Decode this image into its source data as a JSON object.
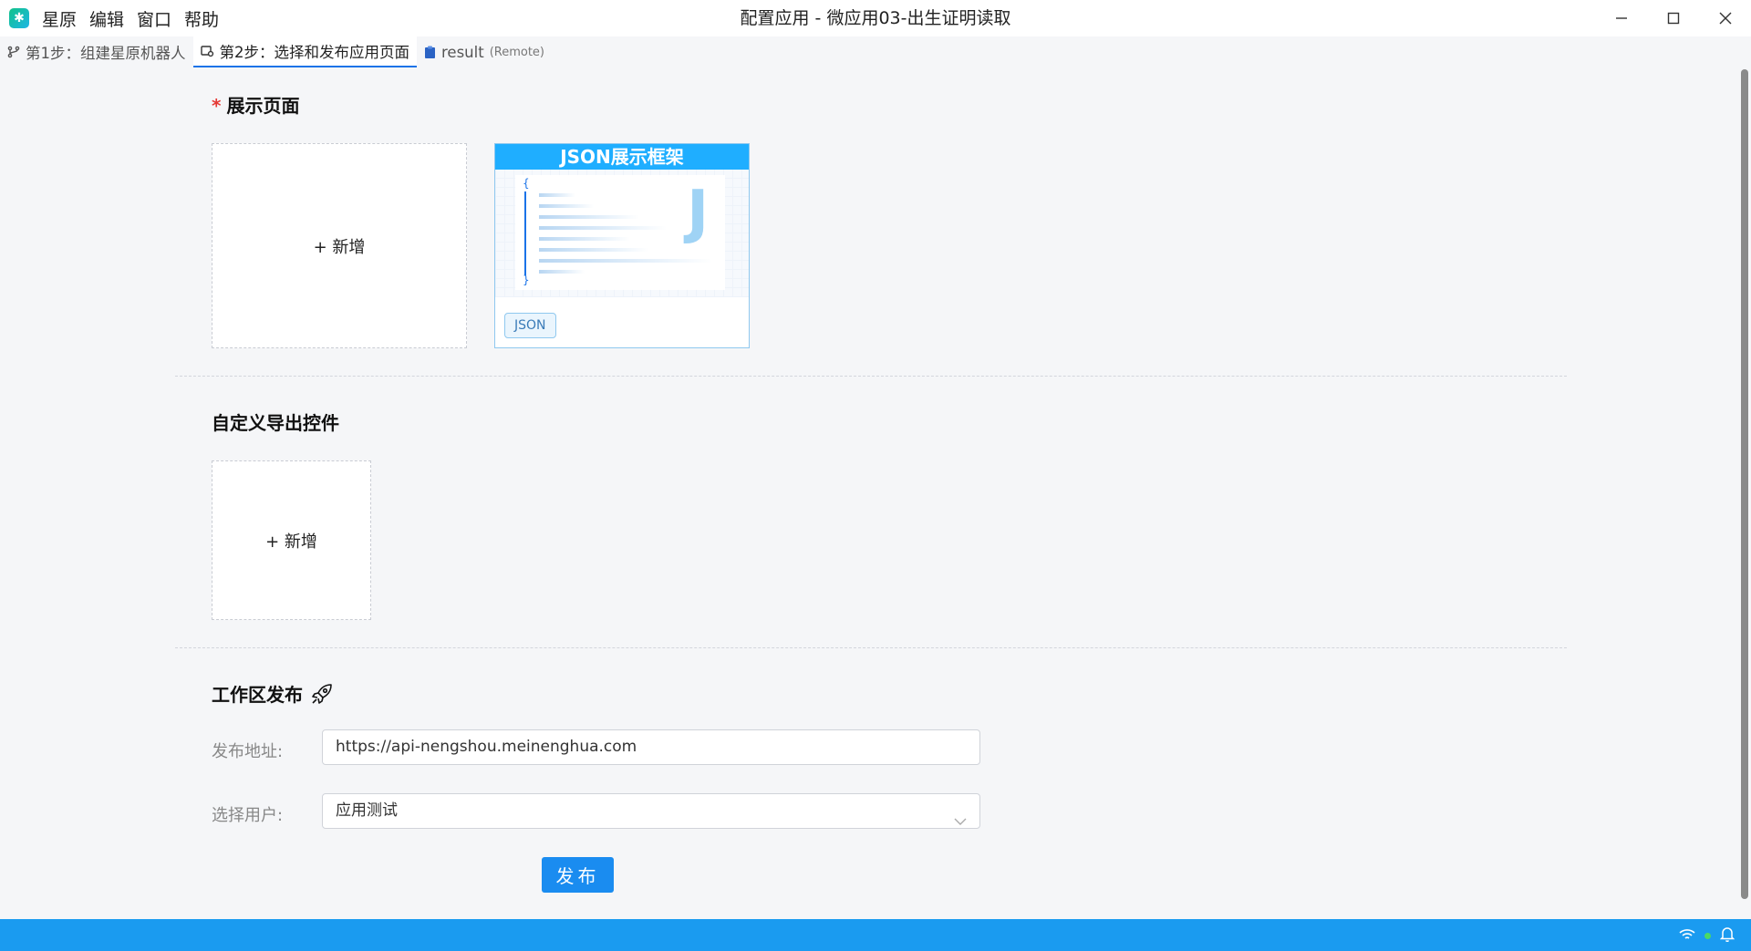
{
  "app": {
    "menu": [
      "星原",
      "编辑",
      "窗口",
      "帮助"
    ],
    "window_title": "配置应用 - 微应用03-出生证明读取"
  },
  "tabs": [
    {
      "label": "第1步：组建星原机器人",
      "icon": "branch-icon"
    },
    {
      "label": "第2步：选择和发布应用页面",
      "icon": "page-settings-icon"
    },
    {
      "label": "result",
      "suffix": "(Remote)",
      "icon": "clipboard-icon"
    }
  ],
  "display_page": {
    "required_mark": "*",
    "title": "展示页面",
    "add_label": "+ 新增",
    "template_card": {
      "header": "JSON展示框架",
      "tag": "JSON",
      "open_brace": "{",
      "close_brace": "}",
      "letter": "J"
    }
  },
  "custom_export": {
    "title": "自定义导出控件",
    "add_label": "+ 新增"
  },
  "workspace_publish": {
    "title": "工作区发布",
    "icon": "rocket-icon",
    "address_label": "发布地址:",
    "address_value": "https://api-nengshou.meinenghua.com",
    "user_label": "选择用户:",
    "user_value": "应用测试",
    "publish_button": "发布"
  },
  "colors": {
    "accent": "#1a8cf0",
    "statusbar": "#1a9bf0",
    "json_header": "#1faeff",
    "required": "#e53935"
  }
}
